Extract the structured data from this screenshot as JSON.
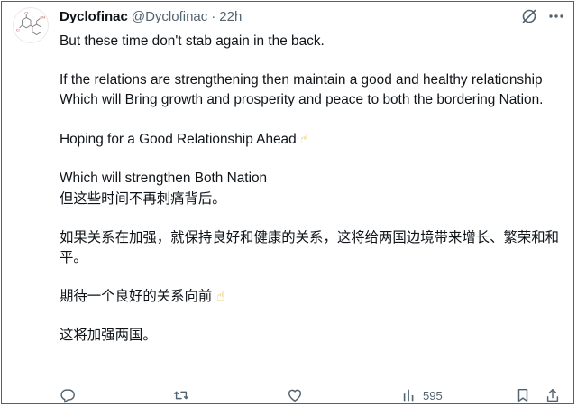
{
  "tweet": {
    "author_name": "Dyclofinac",
    "author_handle": "@Dyclofinac",
    "separator": "·",
    "time": "22h",
    "paragraphs": [
      {
        "text": "But these time don't stab again in the back.",
        "emoji": ""
      },
      {
        "text": "If the relations are strengthening then maintain a good and healthy relationship Which will Bring growth and prosperity and peace to both the bordering Nation.",
        "emoji": ""
      },
      {
        "text": "Hoping for a Good Relationship Ahead",
        "emoji": "☝"
      },
      {
        "text": "Which will strengthen Both Nation",
        "emoji": ""
      },
      {
        "text": "但这些时间不再刺痛背后。",
        "emoji": ""
      },
      {
        "text": "如果关系在加强，就保持良好和健康的关系，这将给两国边境带来增长、繁荣和和平。",
        "emoji": ""
      },
      {
        "text": "期待一个良好的关系向前",
        "emoji": "☝"
      },
      {
        "text": "这将加强两国。",
        "emoji": ""
      }
    ],
    "views_count": "595"
  },
  "icons": {
    "avatar": "chemical-structure-avatar",
    "grok": "grok-icon",
    "more": "more-icon",
    "reply": "reply-icon",
    "retweet": "retweet-icon",
    "like": "like-icon",
    "views": "views-icon",
    "bookmark": "bookmark-icon",
    "share": "share-icon"
  },
  "colors": {
    "frame": "#e0262b",
    "muted": "#536471",
    "text": "#0f1419"
  }
}
